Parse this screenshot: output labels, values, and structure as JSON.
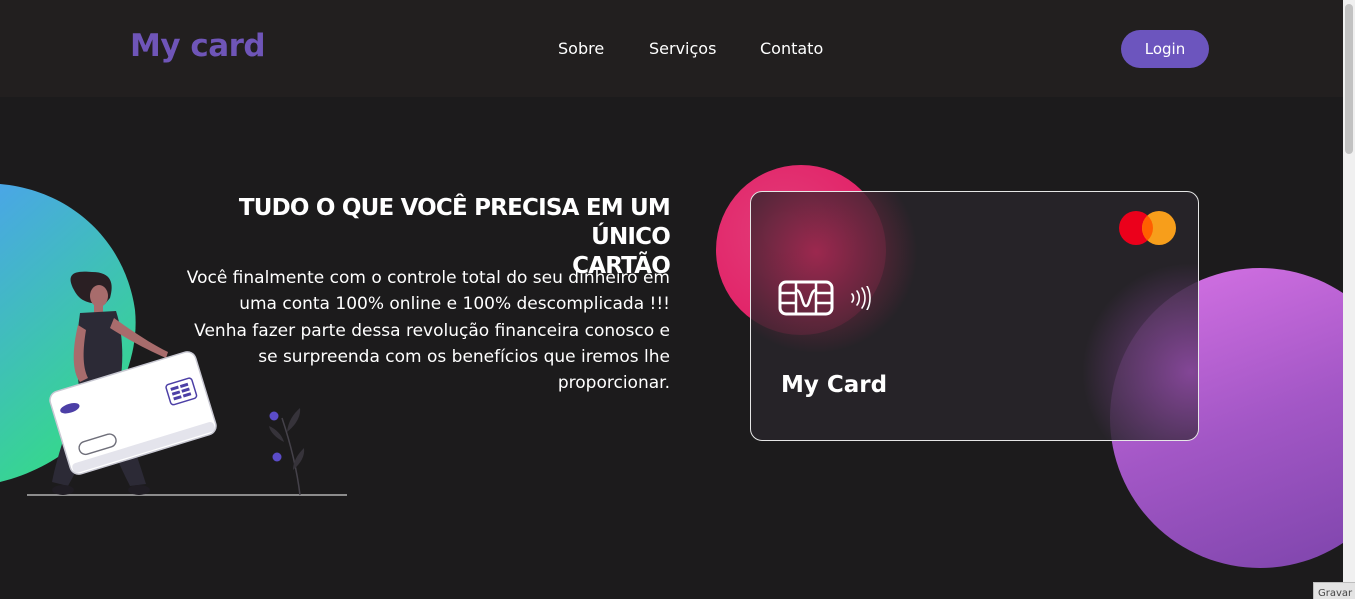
{
  "navbar": {
    "logo": "My card",
    "links": [
      "Sobre",
      "Serviços",
      "Contato"
    ],
    "login_label": "Login"
  },
  "hero": {
    "title_line1": "TUDO O QUE VOCÊ PRECISA EM UM ÚNICO",
    "title_line2": "CARTÃO",
    "text_lines": [
      "Você finalmente com o controle total do seu dinheiro em",
      "uma conta 100% online e 100% descomplicada !!!",
      "Venha fazer parte dessa revolução financeira conosco e",
      "se surpreenda com os benefícios que iremos lhe",
      "proporcionar."
    ]
  },
  "card": {
    "name": "My Card",
    "brand_icon": "mastercard-logo-icon",
    "chip_icon": "chip-icon",
    "contactless_icon": "contactless-icon"
  },
  "colors": {
    "accent": "#6c55be",
    "background": "#1c1b1c",
    "navbar": "#221f1f",
    "pink": "#e2266a",
    "purple": "#a357c6"
  },
  "footer": {
    "corner_label": "Gravar"
  }
}
